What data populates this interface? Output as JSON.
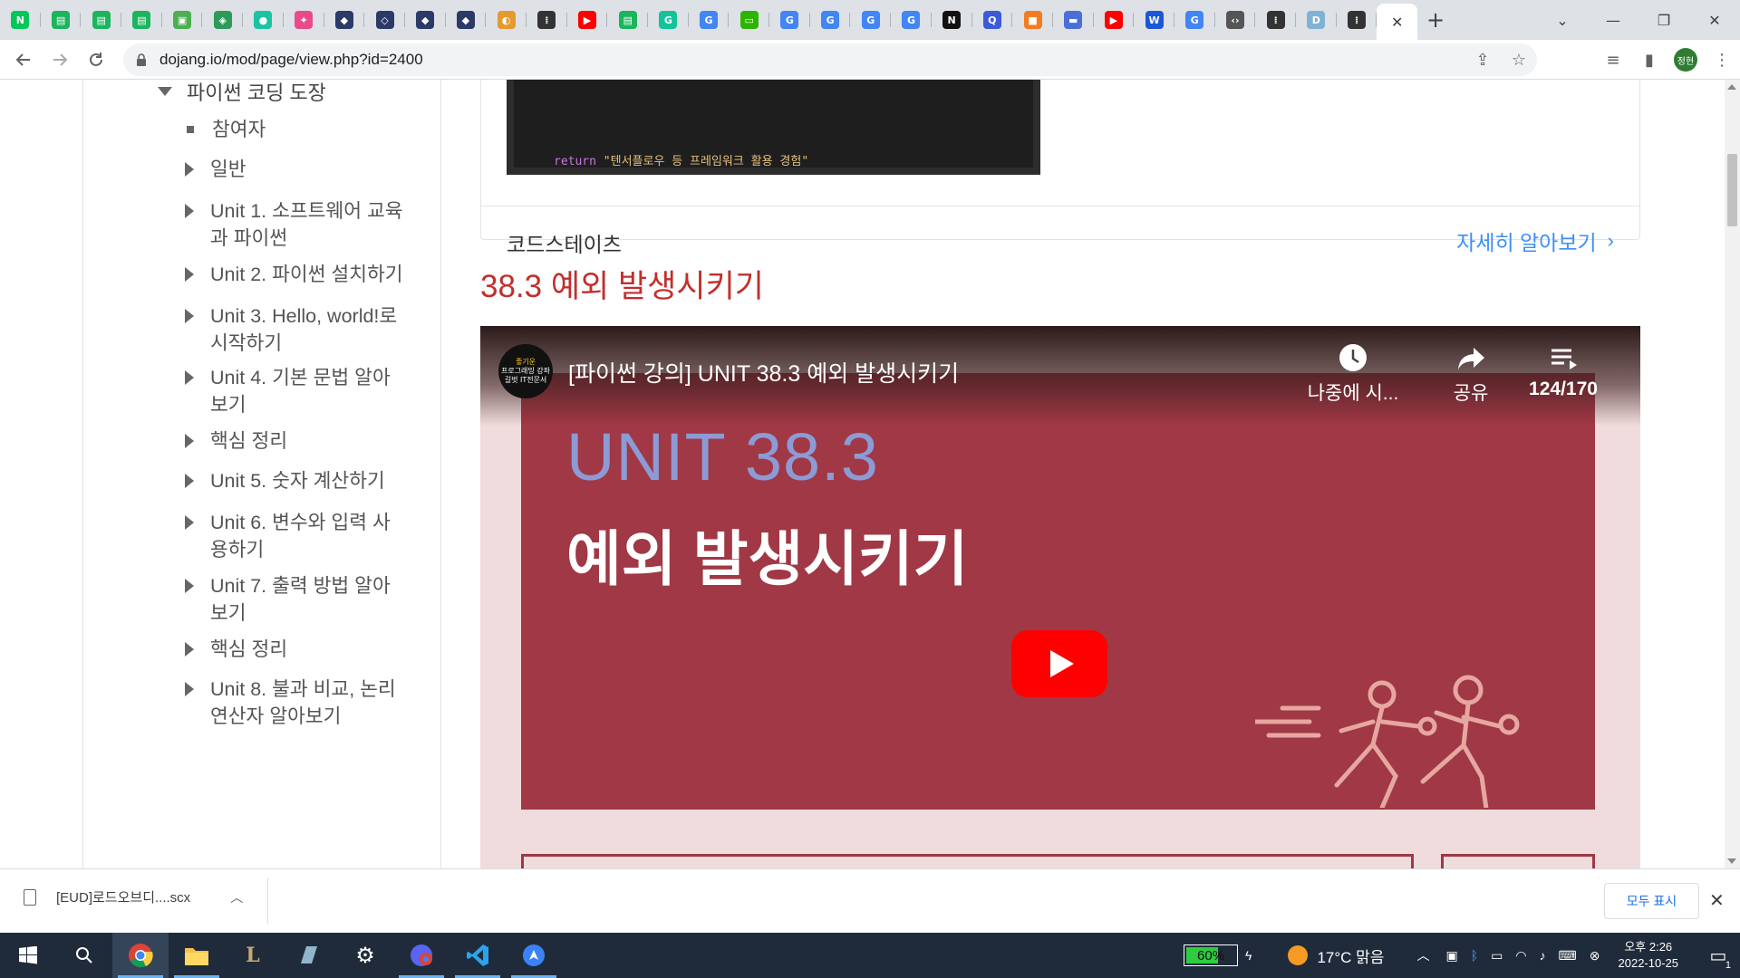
{
  "browser": {
    "tabs_favicons": [
      {
        "icon": "naver-icon",
        "color": "#03c75a",
        "glyph": "N"
      },
      {
        "icon": "green-doc-icon",
        "color": "#1ab55c",
        "glyph": "▤"
      },
      {
        "icon": "green-doc-icon",
        "color": "#1ab55c",
        "glyph": "▤"
      },
      {
        "icon": "green-doc-icon",
        "color": "#1ab55c",
        "glyph": "▤"
      },
      {
        "icon": "green-photo-icon",
        "color": "#4caf50",
        "glyph": "▣"
      },
      {
        "icon": "shield-icon",
        "color": "#2e9a5a",
        "glyph": "◈"
      },
      {
        "icon": "teal-circle-icon",
        "color": "#1cc3a3",
        "glyph": "●"
      },
      {
        "icon": "pink-app-icon",
        "color": "#e94b8a",
        "glyph": "✦"
      },
      {
        "icon": "navy-app-icon",
        "color": "#2b3a67",
        "glyph": "◆"
      },
      {
        "icon": "navy-app-icon",
        "color": "#2b3a67",
        "glyph": "◇"
      },
      {
        "icon": "navy-app-icon",
        "color": "#2b3a67",
        "glyph": "◆"
      },
      {
        "icon": "navy-app-icon",
        "color": "#2b3a67",
        "glyph": "◆"
      },
      {
        "icon": "orange-circle-icon",
        "color": "#e39b2f",
        "glyph": "◐"
      },
      {
        "icon": "dots-icon",
        "color": "#333333",
        "glyph": "⁞"
      },
      {
        "icon": "youtube-icon",
        "color": "#ff0000",
        "glyph": "▶"
      },
      {
        "icon": "green-doc-icon",
        "color": "#1ab55c",
        "glyph": "▤"
      },
      {
        "icon": "grammarly-icon",
        "color": "#15c39a",
        "glyph": "G"
      },
      {
        "icon": "google-icon",
        "color": "#4285f4",
        "glyph": "G"
      },
      {
        "icon": "green-chat-icon",
        "color": "#2db400",
        "glyph": "▭"
      },
      {
        "icon": "google-icon",
        "color": "#4285f4",
        "glyph": "G"
      },
      {
        "icon": "google-icon",
        "color": "#4285f4",
        "glyph": "G"
      },
      {
        "icon": "google-icon",
        "color": "#4285f4",
        "glyph": "G"
      },
      {
        "icon": "google-icon",
        "color": "#4285f4",
        "glyph": "G"
      },
      {
        "icon": "notion-icon",
        "color": "#111111",
        "glyph": "N"
      },
      {
        "icon": "blue-q-icon",
        "color": "#3b5bdb",
        "glyph": "Q"
      },
      {
        "icon": "orange-box-icon",
        "color": "#f47c20",
        "glyph": "■"
      },
      {
        "icon": "blue-tag-icon",
        "color": "#4a6fd6",
        "glyph": "▬"
      },
      {
        "icon": "youtube-icon",
        "color": "#ff0000",
        "glyph": "▶"
      },
      {
        "icon": "blue-w-icon",
        "color": "#1b57d6",
        "glyph": "W"
      },
      {
        "icon": "google-icon",
        "color": "#4285f4",
        "glyph": "G"
      },
      {
        "icon": "code-icon",
        "color": "#555555",
        "glyph": "‹›"
      },
      {
        "icon": "dots-icon",
        "color": "#333333",
        "glyph": "⁞"
      },
      {
        "icon": "dale-icon",
        "color": "#7fb3d5",
        "glyph": "D"
      },
      {
        "icon": "dots-icon",
        "color": "#333333",
        "glyph": "⁞"
      }
    ],
    "active_tab_close": "✕",
    "new_tab": "+",
    "url": "dojang.io/mod/page/view.php?id=2400",
    "profile_initials": "정현"
  },
  "sidebar": {
    "root_label": "파이썬 코딩 도장",
    "items": [
      {
        "type": "leaf",
        "lines": [
          "참여자"
        ]
      },
      {
        "type": "branch",
        "lines": [
          "일반"
        ]
      },
      {
        "type": "branch",
        "lines": [
          "Unit 1. 소프트웨어 교육",
          "과 파이썬"
        ]
      },
      {
        "type": "branch",
        "lines": [
          "Unit 2. 파이썬 설치하기"
        ]
      },
      {
        "type": "branch",
        "lines": [
          "Unit 3. Hello, world!로",
          "시작하기"
        ]
      },
      {
        "type": "branch",
        "lines": [
          "Unit 4. 기본 문법 알아",
          "보기"
        ]
      },
      {
        "type": "branch",
        "lines": [
          "핵심 정리"
        ]
      },
      {
        "type": "branch",
        "lines": [
          "Unit 5. 숫자 계산하기"
        ]
      },
      {
        "type": "branch",
        "lines": [
          "Unit 6. 변수와 입력 사",
          "용하기"
        ]
      },
      {
        "type": "branch",
        "lines": [
          "Unit 7. 출력 방법 알아",
          "보기"
        ]
      },
      {
        "type": "branch",
        "lines": [
          "핵심 정리"
        ]
      },
      {
        "type": "branch",
        "lines": [
          "Unit 8. 불과 비교, 논리",
          "연산자 알아보기"
        ]
      }
    ]
  },
  "main": {
    "code_snippet": {
      "keyword": "return",
      "string": "\"텐서플로우 등 프레임워크 활용 경험\""
    },
    "card_title": "코드스테이츠",
    "card_link": "자세히 알아보기",
    "section_title": "38.3 예외 발생시키기",
    "video": {
      "channel_logo_text": [
        "좋기운",
        "프로그래밍 강좌",
        "길벗 IT전문서"
      ],
      "title": "[파이썬 강의] UNIT 38.3 예외 발생시키기",
      "actions": [
        {
          "icon": "clock-icon",
          "label": "나중에 시..."
        },
        {
          "icon": "share-icon",
          "label": "공유"
        },
        {
          "icon": "playlist-icon",
          "label": "124/170"
        }
      ],
      "slide_unit": "UNIT 38.3",
      "slide_title": "예외 발생시키기",
      "accent": "#a03845"
    }
  },
  "downloads": {
    "filename": "[EUD]로드오브디....scx",
    "show_all": "모두 표시"
  },
  "taskbar": {
    "battery": "60%",
    "battery_level": 0.6,
    "weather": "17°C  맑음",
    "time": "오후 2:26",
    "date": "2022-10-25",
    "notification_count": "1"
  }
}
